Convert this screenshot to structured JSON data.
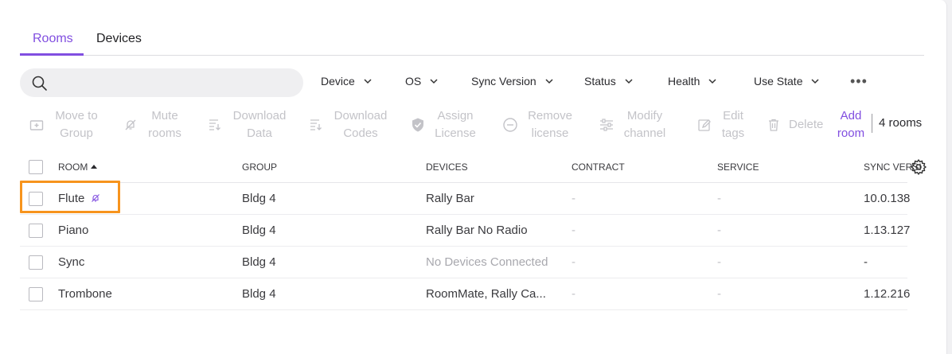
{
  "tabs": [
    {
      "label": "Rooms",
      "active": true
    },
    {
      "label": "Devices",
      "active": false
    }
  ],
  "search": {
    "placeholder": "",
    "value": ""
  },
  "filters": [
    "Device",
    "OS",
    "Sync Version",
    "Status",
    "Health",
    "Use State"
  ],
  "more_label": "•••",
  "toolbar": {
    "move_to_group": "Move to Group",
    "mute_rooms": "Mute rooms",
    "download_data": "Download Data",
    "download_codes": "Download Codes",
    "assign_license": "Assign License",
    "remove_license": "Remove license",
    "modify_channel": "Modify channel",
    "edit_tags": "Edit tags",
    "delete": "Delete",
    "add_room": "Add room",
    "room_count": "4 rooms"
  },
  "table": {
    "headers": {
      "room": "ROOM",
      "group": "GROUP",
      "devices": "DEVICES",
      "contract": "CONTRACT",
      "service": "SERVICE",
      "sync_version": "SYNC VERSION"
    },
    "rows": [
      {
        "room": "Flute",
        "group": "Bldg 4",
        "devices": "Rally Bar",
        "contract": "-",
        "service": "-",
        "sync_version": "10.0.138",
        "muted": true
      },
      {
        "room": "Piano",
        "group": "Bldg 4",
        "devices": "Rally Bar No Radio",
        "contract": "-",
        "service": "-",
        "sync_version": "1.13.127",
        "muted": false
      },
      {
        "room": "Sync",
        "group": "Bldg 4",
        "devices": "No Devices Connected",
        "contract": "-",
        "service": "-",
        "sync_version": "-",
        "muted": false
      },
      {
        "room": "Trombone",
        "group": "Bldg 4",
        "devices": "RoomMate, Rally Ca...",
        "contract": "-",
        "service": "-",
        "sync_version": "1.12.216",
        "muted": false
      }
    ]
  },
  "colors": {
    "accent": "#814ee0",
    "highlight": "#f7941d",
    "disabled": "#c3c3c8"
  },
  "icons": [
    "search-icon",
    "chevron-down-icon",
    "move-to-group-icon",
    "mute-icon",
    "download-icon",
    "shield-check-icon",
    "minus-circle-icon",
    "sliders-icon",
    "edit-icon",
    "trash-icon",
    "sort-up-icon",
    "gear-icon"
  ]
}
